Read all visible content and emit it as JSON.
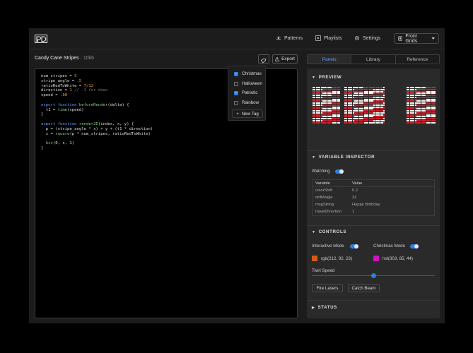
{
  "nav": {
    "patterns": "Patterns",
    "playlists": "Playlists",
    "settings": "Settings",
    "device": "Front Grids"
  },
  "pattern": {
    "name": "Candy Cane Stripes",
    "size": "· 10kb"
  },
  "toolbar": {
    "export": "Export"
  },
  "tabs": [
    "Panels",
    "Library",
    "Reference"
  ],
  "code": [
    "num_stripes = 5",
    "stripe_angle = .5",
    "ratioRedToWhite = 7/12",
    "direction = 1 // -1 for down",
    "speed = .08",
    "",
    "export function beforeRender(delta) {",
    "  t1 = time(speed)",
    "}",
    "",
    "export function render2D(index, x, y) {",
    "  p = (stripe_angle * x) + y + (t1 * direction)",
    "  s = square(p * num_stripes, ratioRedToWhite)",
    "",
    "  hsv(0, s, 1)",
    "}"
  ],
  "tags": {
    "items": [
      {
        "label": "Christmas",
        "checked": true
      },
      {
        "label": "Halloween",
        "checked": false
      },
      {
        "label": "Patriotic",
        "checked": true
      },
      {
        "label": "Rainbow",
        "checked": false
      }
    ],
    "new_tag": "New Tag"
  },
  "panel": {
    "preview_title": "PREVIEW",
    "inspector_title": "VARIABLE INSPECTOR",
    "watching": "Watching",
    "table_headers": [
      "Variable",
      "Value"
    ],
    "variables": [
      [
        "colorShift",
        "0.2"
      ],
      [
        "driftAngle",
        "32"
      ],
      [
        "msgString",
        "Happy Birthday"
      ],
      [
        "travelDirection",
        "1"
      ]
    ],
    "controls_title": "CONTROLS",
    "interactive_mode": "Interactive Mode",
    "christmas_mode": "Christmas Mode",
    "color1": "rgb(212, 92, 23)",
    "color1_hex": "#d45c17",
    "color2": "hsl(303, 85, 44)",
    "color2_hex": "#cf11c3",
    "twirl_speed": "Twirl Speed",
    "twirl_value": 0.5,
    "fire_lasers": "Fire Lasers",
    "catch_beam": "Catch Beam",
    "status_title": "STATUS"
  },
  "colors": {
    "accent": "#2f7de1",
    "stripe_red": "#c8232c",
    "stripe_white": "#f2f2f2"
  }
}
